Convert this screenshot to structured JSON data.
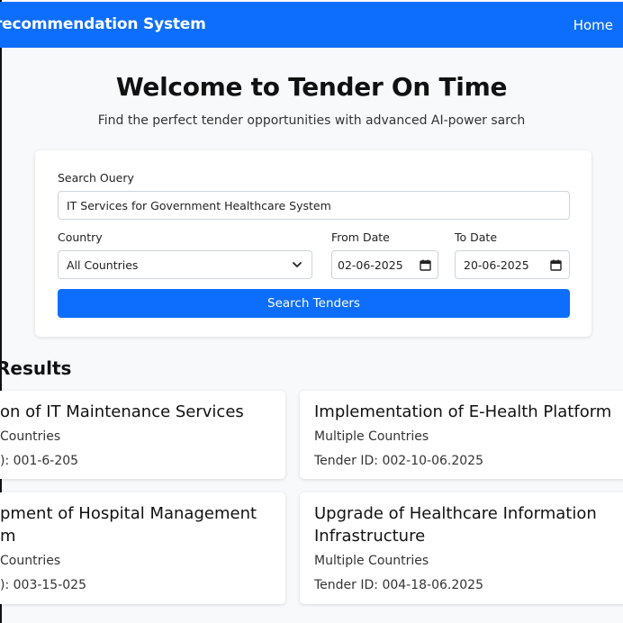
{
  "navbar": {
    "brand": "recommendation System",
    "home_link": "Home"
  },
  "hero": {
    "title": "Welcome to Tender On Time",
    "subtitle": "Find the perfect tender opportunities with advanced AI-power sarch"
  },
  "search_form": {
    "query_label": "Search Ouery",
    "query_value": "IT Services for Government Healthcare System",
    "country_label": "Country",
    "country_value": "All Countries",
    "from_date_label": "From Date",
    "from_date_value": "02-06-2025",
    "to_date_label": "To Date",
    "to_date_value": "20-06-2025",
    "submit_label": "Search Tenders"
  },
  "results": {
    "title": "Results",
    "cards": [
      {
        "title_line1": "on of IT Maintenance Services",
        "title_line2": "",
        "countries": "Countries",
        "tender_id": "): 001-6-205"
      },
      {
        "title_line1": "Implementation of E-Health Platform",
        "title_line2": "",
        "countries": "Multiple Countries",
        "tender_id": "Tender ID: 002-10-06.2025"
      },
      {
        "title_line1": "pment of Hospital Management",
        "title_line2": "m",
        "countries": "Countries",
        "tender_id": "): 003-15-025"
      },
      {
        "title_line1": "Upgrade of Healthcare Information",
        "title_line2": "Infrastructure",
        "countries": "Multiple Countries",
        "tender_id": "Tender ID: 004-18-06.2025"
      }
    ]
  },
  "icons": {
    "country_select": "chevron-down-icon",
    "date_picker": "calendar-icon"
  },
  "colors": {
    "primary": "#0d6efd",
    "page_background": "#f8f9fb",
    "card_background": "#ffffff"
  }
}
